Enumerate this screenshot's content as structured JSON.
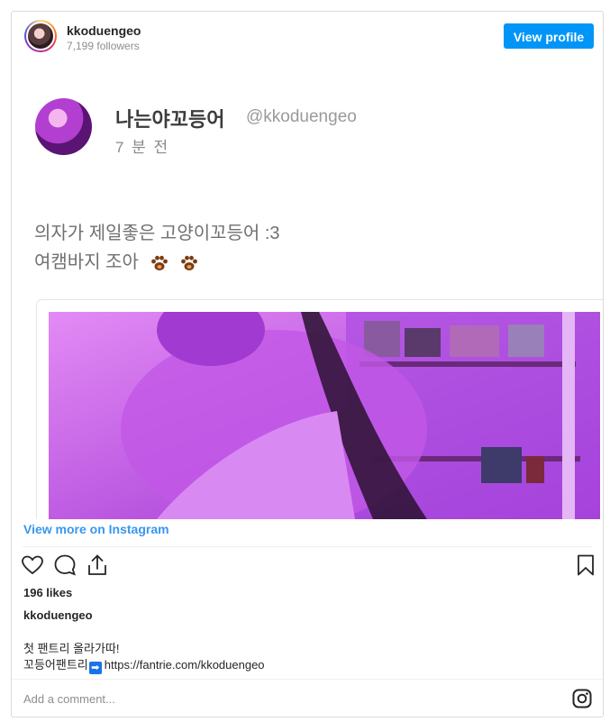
{
  "header": {
    "username": "kkoduengeo",
    "followers": "7,199 followers",
    "view_profile": "View profile"
  },
  "tweet": {
    "display_name": "나는야꼬등어",
    "handle": "@kkoduengeo",
    "time": "7 분 전",
    "line1": "의자가 제일좋은 고양이꼬등어 :3",
    "line2": "여캠바지 조아"
  },
  "links": {
    "view_more": "View more on Instagram"
  },
  "stats": {
    "likes": "196 likes"
  },
  "caption": {
    "username": "kkoduengeo",
    "line1": "첫 팬트리 올라가따!",
    "line2_prefix": "꼬등어팬트리",
    "line2_url": "https://fantrie.com/kkoduengeo"
  },
  "comment": {
    "placeholder": "Add a comment..."
  },
  "icons": [
    "heart-icon",
    "comment-icon",
    "share-icon",
    "bookmark-icon",
    "instagram-icon",
    "paw-icon"
  ],
  "colors": {
    "accent": "#0095f6",
    "link": "#3897f0",
    "photo_tint": "#b23fcf"
  }
}
